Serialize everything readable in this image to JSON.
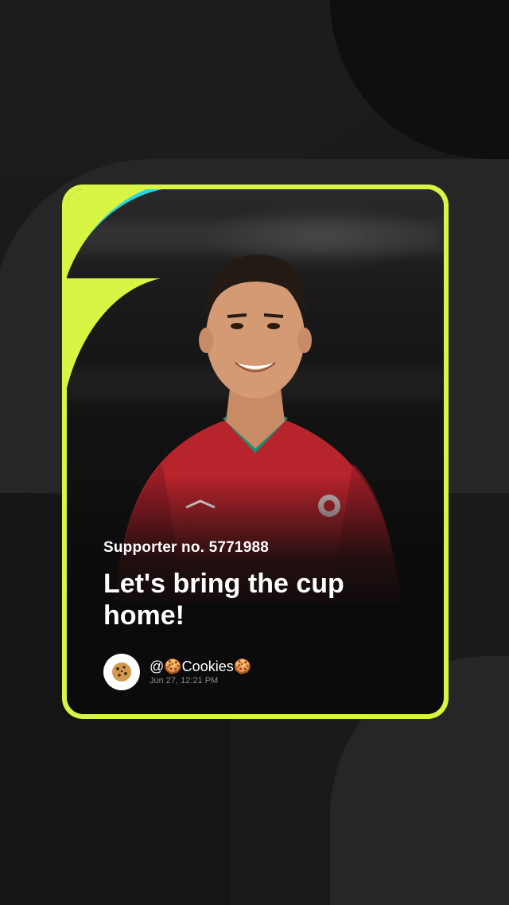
{
  "post": {
    "supporter_label": "Supporter no. 5771988",
    "headline": "Let's bring the cup home!",
    "author": {
      "username": "@🍪Cookies🍪",
      "avatar_icon": "cookie-icon",
      "timestamp": "Jun 27, 12:21 PM"
    },
    "colors": {
      "card_border": "#d7f542",
      "corner_accent": "#2ad8e0",
      "jersey": "#b8242c"
    }
  }
}
